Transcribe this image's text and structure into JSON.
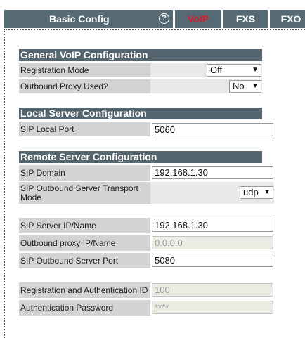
{
  "tabs": {
    "basic_config": "Basic Config",
    "help_icon": "?",
    "voip": "VoIP",
    "fxs": "FXS",
    "fxo": "FXO"
  },
  "general": {
    "title": "General VoIP Configuration",
    "registration_mode_label": "Registration Mode",
    "registration_mode_value": "Off",
    "outbound_proxy_used_label": "Outbound Proxy Used?",
    "outbound_proxy_used_value": "No"
  },
  "local_server": {
    "title": "Local Server Configuration",
    "sip_local_port_label": "SIP Local Port",
    "sip_local_port_value": "5060"
  },
  "remote_server": {
    "title": "Remote Server Configuration",
    "sip_domain_label": "SIP Domain",
    "sip_domain_value": "192.168.1.30",
    "transport_mode_label": "SIP Outbound Server Transport Mode",
    "transport_mode_value": "udp",
    "sip_server_label": "SIP Server IP/Name",
    "sip_server_value": "192.168.1.30",
    "outbound_proxy_label": "Outbound proxy IP/Name",
    "outbound_proxy_value": "0.0.0.0",
    "outbound_server_port_label": "SIP Outbound Server Port",
    "outbound_server_port_value": "5080",
    "auth_id_label": "Registration and Authentication ID",
    "auth_id_value": "100",
    "auth_password_label": "Authentication Password",
    "auth_password_value": "****"
  },
  "colors": {
    "tab_bg": "#556a72",
    "tab_active_text": "#e0192a",
    "section_header_bg": "#55656d",
    "label_bg": "#d3d3d3",
    "value_bg": "#e9e9e9"
  }
}
